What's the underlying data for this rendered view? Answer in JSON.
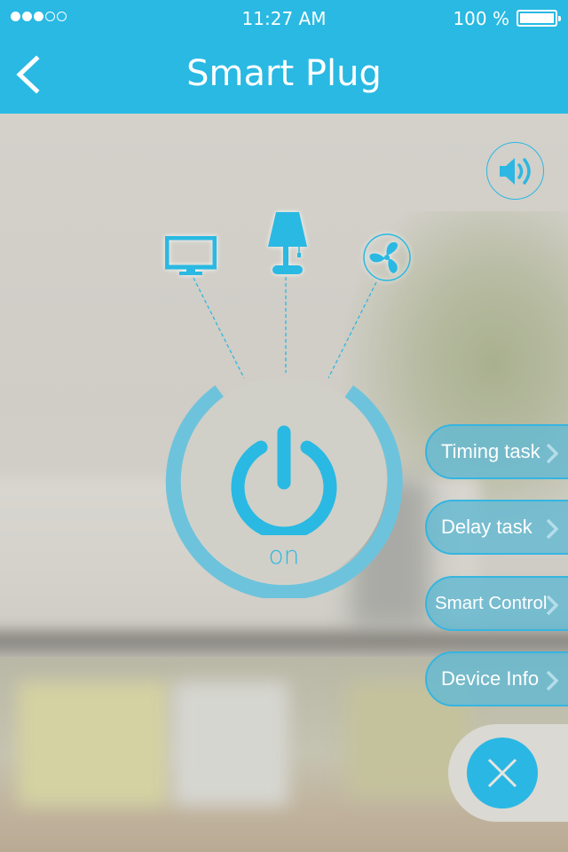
{
  "status_bar": {
    "signal_bars_filled": 3,
    "signal_bars_total": 5,
    "time": "11:27 AM",
    "battery_percent": "100 %",
    "battery_level": 1.0
  },
  "header": {
    "title": "Smart Plug",
    "back_icon": "chevron-left-icon"
  },
  "colors": {
    "accent": "#29b9e3",
    "header_bg": "#29b9e3",
    "menu_button_bg": "#64b9d2"
  },
  "sound": {
    "icon": "speaker-icon"
  },
  "devices": [
    {
      "name": "tv",
      "icon": "monitor-icon"
    },
    {
      "name": "lamp",
      "icon": "lamp-icon"
    },
    {
      "name": "fan",
      "icon": "fan-icon"
    }
  ],
  "power": {
    "icon": "power-icon",
    "state_label": "on"
  },
  "menu": [
    {
      "label": "Timing task",
      "icon": "chevron-right-icon"
    },
    {
      "label": "Delay task",
      "icon": "chevron-right-icon"
    },
    {
      "label": "Smart Control",
      "icon": "chevron-right-icon"
    },
    {
      "label": "Device Info",
      "icon": "chevron-right-icon"
    }
  ],
  "close": {
    "icon": "close-icon"
  }
}
